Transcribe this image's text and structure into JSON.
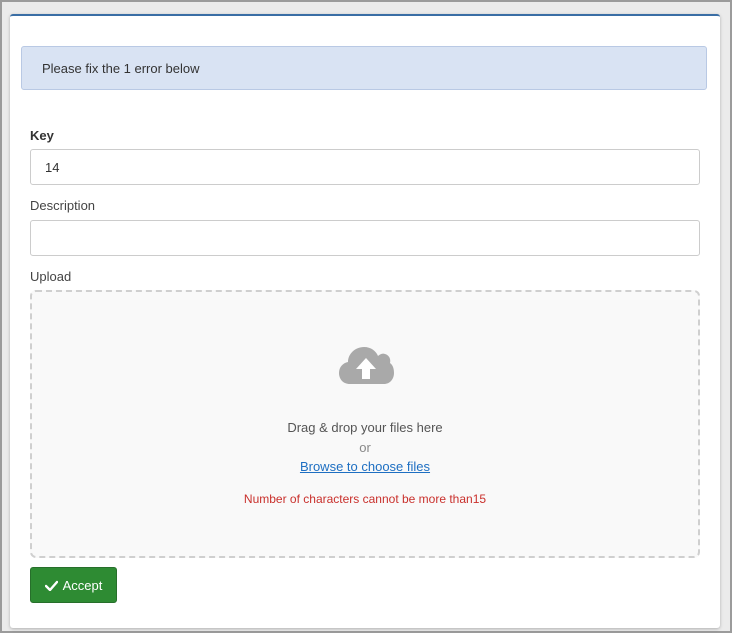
{
  "alert": {
    "message": "Please fix the 1 error below"
  },
  "form": {
    "key": {
      "label": "Key",
      "value": "14"
    },
    "description": {
      "label": "Description",
      "value": ""
    },
    "upload": {
      "label": "Upload",
      "icon": "cloud-upload-icon",
      "drag_text": "Drag & drop your files here",
      "or_text": "or",
      "browse_link": "Browse to choose files",
      "error": "Number of characters cannot be more than15"
    },
    "accept_button": {
      "label": "Accept",
      "icon": "check-icon"
    }
  },
  "colors": {
    "accent": "#3a6ea5",
    "alert_bg": "#d9e3f3",
    "error": "#c9302c",
    "link": "#1e6fc2",
    "success_button": "#2e8b33"
  }
}
